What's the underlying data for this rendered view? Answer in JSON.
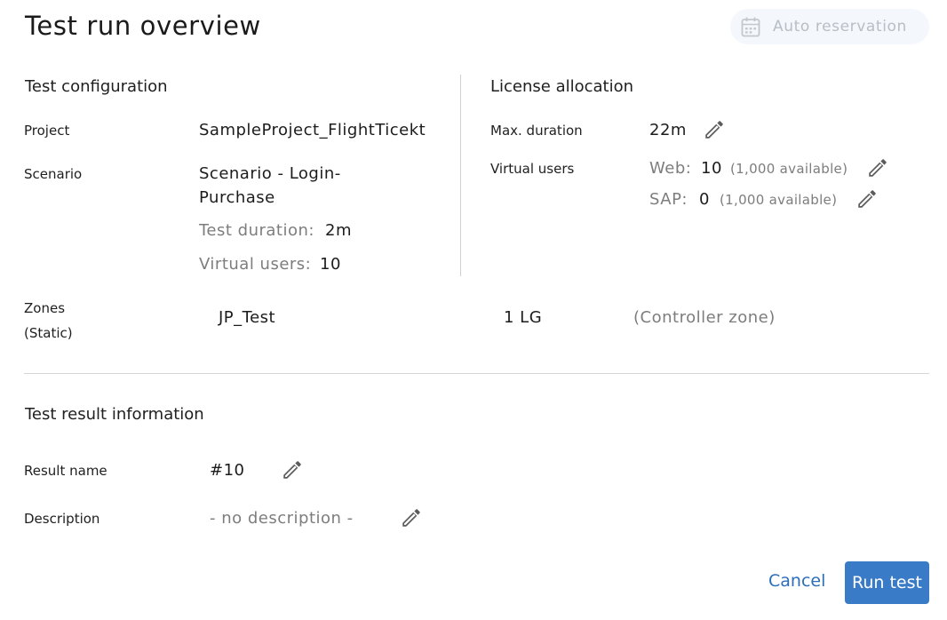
{
  "header": {
    "title": "Test run overview",
    "auto_reservation_label": "Auto reservation"
  },
  "test_configuration": {
    "heading": "Test configuration",
    "project_label": "Project",
    "project_value": "SampleProject_FlightTicekt",
    "scenario_label": "Scenario",
    "scenario_value_line1": "Scenario - Login-",
    "scenario_value_line2": "Purchase",
    "test_duration_label": "Test duration:",
    "test_duration_value": "2m",
    "virtual_users_label": "Virtual users:",
    "virtual_users_value": "10"
  },
  "license_allocation": {
    "heading": "License allocation",
    "max_duration_label": "Max. duration",
    "max_duration_value": "22m",
    "virtual_users_label": "Virtual users",
    "web_label": "Web:",
    "web_value": "10",
    "web_available": "(1,000 available)",
    "sap_label": "SAP:",
    "sap_value": "0",
    "sap_available": "(1,000 available)"
  },
  "zones": {
    "label": "Zones",
    "sublabel": "(Static)",
    "name": "JP_Test",
    "lg_count": "1 LG",
    "zone_type": "(Controller zone)"
  },
  "test_result": {
    "heading": "Test result information",
    "result_name_label": "Result name",
    "result_name_value": "#10",
    "description_label": "Description",
    "description_value": "- no description -"
  },
  "footer": {
    "cancel_label": "Cancel",
    "run_label": "Run test"
  },
  "colors": {
    "accent": "#3a7bc8",
    "link": "#2c6fb8",
    "muted": "#7d7d7d",
    "divider": "#d0d0d0"
  },
  "icons": {
    "edit": "pencil-icon",
    "calendar": "calendar-icon"
  }
}
